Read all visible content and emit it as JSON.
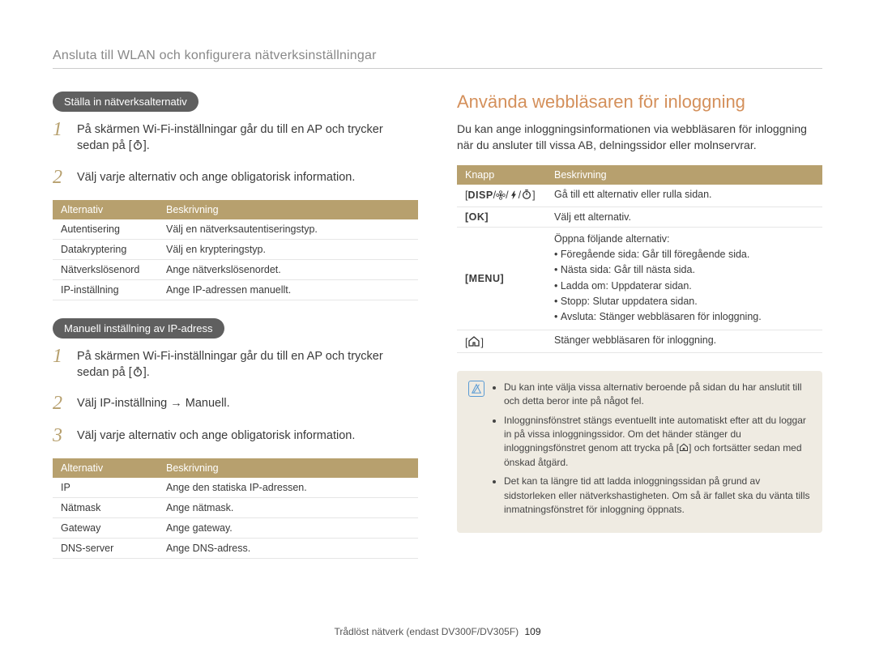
{
  "breadcrumb": "Ansluta till WLAN och konfigurera nätverksinställningar",
  "left": {
    "section1_title": "Ställa in nätverksalternativ",
    "step1a": "På skärmen Wi-Fi-inställningar går du till en AP och trycker sedan på [",
    "step1b": "].",
    "step2": "Välj varje alternativ och ange obligatorisk information.",
    "table1": {
      "headers": [
        "Alternativ",
        "Beskrivning"
      ],
      "rows": [
        [
          "Autentisering",
          "Välj en nätverksautentiseringstyp."
        ],
        [
          "Datakryptering",
          "Välj en krypteringstyp."
        ],
        [
          "Nätverkslösenord",
          "Ange nätverkslösenordet."
        ],
        [
          "IP-inställning",
          "Ange IP-adressen manuellt."
        ]
      ]
    },
    "section2_title": "Manuell inställning av IP-adress",
    "s2_step1a": "På skärmen Wi-Fi-inställningar går du till en AP och trycker sedan på [",
    "s2_step1b": "].",
    "s2_step2_prefix": "Välj ",
    "s2_step2_bold": "IP-inställning → Manuell",
    "s2_step2_suffix": ".",
    "s2_step3": "Välj varje alternativ och ange obligatorisk information.",
    "table2": {
      "headers": [
        "Alternativ",
        "Beskrivning"
      ],
      "rows": [
        [
          "IP",
          "Ange den statiska IP-adressen."
        ],
        [
          "Nätmask",
          "Ange nätmask."
        ],
        [
          "Gateway",
          "Ange gateway."
        ],
        [
          "DNS-server",
          "Ange DNS-adress."
        ]
      ]
    }
  },
  "right": {
    "heading": "Använda webbläsaren för inloggning",
    "intro": "Du kan ange inloggningsinformationen via webbläsaren för inloggning när du ansluter till vissa AB, delningssidor eller molnservrar.",
    "table": {
      "headers": [
        "Knapp",
        "Beskrivning"
      ],
      "row1_key_a": "[",
      "row1_key_disp": "DISP",
      "row1_key_b": "]",
      "row1_desc": "Gå till ett alternativ eller rulla sidan.",
      "row2_key": "[OK]",
      "row2_desc": "Välj ett alternativ.",
      "row3_key": "[MENU]",
      "row3_desc_head": "Öppna följande alternativ:",
      "row3_items": [
        {
          "label": "Föregående sida",
          "desc": ": Går till föregående sida."
        },
        {
          "label": "Nästa sida",
          "desc": ": Går till nästa sida."
        },
        {
          "label": "Ladda om",
          "desc": ": Uppdaterar sidan."
        },
        {
          "label": "Stopp",
          "desc": ": Slutar uppdatera sidan."
        },
        {
          "label": "Avsluta",
          "desc": ": Stänger webbläsaren för inloggning."
        }
      ],
      "row4_desc": "Stänger webbläsaren för inloggning."
    },
    "note": [
      "Du kan inte välja vissa alternativ beroende på sidan du har anslutit till och detta beror inte på något fel.",
      "Inloggninsfönstret stängs eventuellt inte automatiskt efter att du loggar in på vissa inloggningssidor. Om det händer stänger du inloggningsfönstret genom att trycka på [",
      "] och fortsätter sedan med önskad åtgärd.",
      "Det kan ta längre tid att ladda inloggningssidan på grund av sidstorleken eller nätverkshastigheten. Om så är fallet ska du vänta tills inmatningsfönstret för inloggning öppnats."
    ]
  },
  "footer": {
    "text": "Trådlöst nätverk (endast DV300F/DV305F)",
    "page": "109"
  }
}
